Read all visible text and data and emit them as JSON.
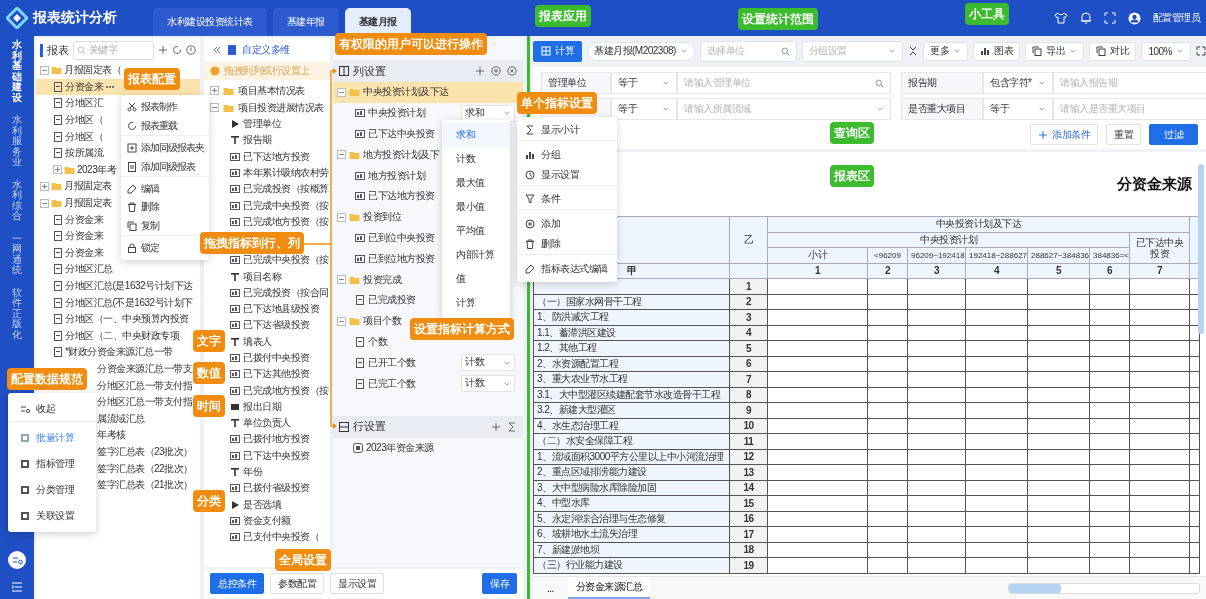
{
  "header": {
    "title": "报表统计分析",
    "tabs": [
      {
        "label": "水利建设投资统计表",
        "selected": false
      },
      {
        "label": "基建年报",
        "selected": false
      },
      {
        "label": "基建月报",
        "selected": true
      }
    ],
    "user": "配置管理员"
  },
  "nav": {
    "items": [
      {
        "label": "水利基础建设",
        "selected": true
      },
      {
        "label": "水利服务业",
        "selected": false
      },
      {
        "label": "水利综合",
        "selected": false
      },
      {
        "label": "一网通统",
        "selected": false
      },
      {
        "label": "软件正版化",
        "selected": false
      }
    ]
  },
  "report_panel": {
    "title": "报表",
    "search_placeholder": "关键字",
    "tree": [
      {
        "label": "月报固定表（",
        "kind": "folder",
        "expanded": true,
        "selected": false,
        "children": [
          {
            "label": "分资金来",
            "kind": "report",
            "selected": true
          },
          {
            "label": "分地区汇",
            "kind": "report",
            "selected": false
          },
          {
            "label": "分地区（",
            "kind": "report",
            "selected": false
          },
          {
            "label": "分地区（",
            "kind": "report",
            "selected": false
          },
          {
            "label": "按所属流",
            "kind": "report",
            "selected": false
          },
          {
            "label": "2023年考",
            "kind": "folder",
            "expanded": false,
            "selected": false
          }
        ]
      },
      {
        "label": "月报固定表",
        "kind": "folder",
        "expanded": false,
        "selected": false
      },
      {
        "label": "月报固定表",
        "kind": "folder",
        "expanded": true,
        "selected": false,
        "children": [
          {
            "label": "分资金来",
            "kind": "report",
            "selected": false
          },
          {
            "label": "分资金来",
            "kind": "report",
            "selected": false
          },
          {
            "label": "分资金来",
            "kind": "report",
            "selected": false
          },
          {
            "label": "分地区汇总",
            "kind": "report",
            "selected": false
          },
          {
            "label": "分地区汇总(是1632号计划下达",
            "kind": "report",
            "selected": false
          },
          {
            "label": "分地区汇总(不是1632号计划下",
            "kind": "report",
            "selected": false
          },
          {
            "label": "分地区（一、中央预算内投资",
            "kind": "report",
            "selected": false
          },
          {
            "label": "分地区（二、中央财政专项",
            "kind": "report",
            "selected": false
          },
          {
            "label": "*财政分资金来源汇总一带",
            "kind": "report",
            "selected": false
          },
          {
            "label": "分资金来源汇总一带支",
            "kind": "cut",
            "selected": false
          },
          {
            "label": "分地区汇总一带支付指",
            "kind": "cut",
            "selected": false
          },
          {
            "label": "分地区汇总一带支付指",
            "kind": "cut",
            "selected": false
          },
          {
            "label": "属流域汇总",
            "kind": "cut",
            "selected": false
          },
          {
            "label": "年考核",
            "kind": "cut",
            "selected": false
          },
          {
            "label": "签字汇总表（23批次）",
            "kind": "cut",
            "selected": false
          },
          {
            "label": "签字汇总表（22批次）",
            "kind": "cut",
            "selected": false
          },
          {
            "label": "签字汇总表（21批次）",
            "kind": "cut",
            "selected": false
          }
        ]
      }
    ]
  },
  "context_menu": [
    {
      "label": "报表制作",
      "kind": "make"
    },
    {
      "label": "报表重载",
      "kind": "reload",
      "divider": true
    },
    {
      "label": "添加同级报表夹",
      "kind": "addfolder"
    },
    {
      "label": "添加同级报表",
      "kind": "addreport",
      "divider": true
    },
    {
      "label": "编辑",
      "kind": "edit"
    },
    {
      "label": "删除",
      "kind": "delete"
    },
    {
      "label": "复制",
      "kind": "copy",
      "divider": true
    },
    {
      "label": "锁定",
      "kind": "lock"
    }
  ],
  "dimension_panel": {
    "title": "自定义多维",
    "hint": "拖拽到列或行设置上",
    "groups": [
      {
        "label": "项目基本情况表",
        "expanded": false
      },
      {
        "label": "项目投资进展情况表",
        "expanded": true,
        "fields": [
          {
            "label": "管理单位",
            "kind": "dimension"
          },
          {
            "label": "报告期",
            "kind": "text"
          },
          {
            "label": "已下达地方投资",
            "kind": "number"
          },
          {
            "label": "本年累计吸纳农村劳",
            "kind": "number"
          },
          {
            "label": "已完成投资（按概算",
            "kind": "number"
          },
          {
            "label": "已完成中央投资（按",
            "kind": "number"
          },
          {
            "label": "已完成地方投资（按",
            "kind": "number"
          },
          {
            "label": "已完成中央投资（按",
            "kind": "number"
          },
          {
            "label": "项目名称",
            "kind": "text"
          },
          {
            "label": "已完成投资（按合同",
            "kind": "number"
          },
          {
            "label": "已下达地县级投资",
            "kind": "number"
          },
          {
            "label": "已下达省级投资",
            "kind": "number"
          },
          {
            "label": "填表人",
            "kind": "text"
          },
          {
            "label": "已拨付中央投资",
            "kind": "number"
          },
          {
            "label": "已下达其他投资",
            "kind": "number"
          },
          {
            "label": "已完成地方投资（按",
            "kind": "number"
          },
          {
            "label": "报出日期",
            "kind": "date"
          },
          {
            "label": "单位负责人",
            "kind": "text"
          },
          {
            "label": "已拨付地方投资",
            "kind": "number"
          },
          {
            "label": "已下达中央投资",
            "kind": "number"
          },
          {
            "label": "年份",
            "kind": "text"
          },
          {
            "label": "已拨付省级投资",
            "kind": "number"
          },
          {
            "label": "是否选填",
            "kind": "dimension"
          },
          {
            "label": "资金支付额",
            "kind": "number"
          },
          {
            "label": "已支付中央投资（",
            "kind": "number"
          }
        ]
      }
    ]
  },
  "column_settings": {
    "title": "列设置",
    "items": [
      {
        "label": "中央投资计划及下达",
        "selected": true,
        "expanded": true,
        "children": [
          {
            "label": "中央投资计划",
            "kind": "number",
            "aggregate": "求和",
            "selected": false
          },
          {
            "label": "已下达中央投资",
            "kind": "number",
            "selected": false
          }
        ]
      },
      {
        "label": "地方投资计划及下",
        "selected": false,
        "expanded": true,
        "children": [
          {
            "label": "地方投资计划",
            "kind": "number",
            "selected": false
          },
          {
            "label": "已下达地方投资",
            "kind": "number",
            "selected": false
          }
        ]
      },
      {
        "label": "投资到位",
        "selected": false,
        "expanded": true,
        "children": [
          {
            "label": "已到位中央投资",
            "kind": "number",
            "selected": false
          },
          {
            "label": "已到位地方投资",
            "kind": "number",
            "selected": false
          }
        ]
      },
      {
        "label": "投资完成",
        "selected": false,
        "expanded": true,
        "children": [
          {
            "label": "已完成投资",
            "kind": "doc",
            "selected": false
          }
        ]
      },
      {
        "label": "项目个数",
        "selected": false,
        "expanded": true,
        "children": [
          {
            "label": "个数",
            "kind": "doc",
            "selected": false
          },
          {
            "label": "已开工个数",
            "kind": "doc",
            "aggregate": "计数",
            "selected": false
          },
          {
            "label": "已完工个数",
            "kind": "doc",
            "aggregate": "计数",
            "selected": false
          }
        ]
      }
    ]
  },
  "aggregate_menu": [
    {
      "label": "求和",
      "selected": true
    },
    {
      "label": "计数",
      "selected": false
    },
    {
      "label": "最大值",
      "selected": false
    },
    {
      "label": "最小值",
      "selected": false
    },
    {
      "label": "平均值",
      "selected": false
    },
    {
      "label": "内部计算",
      "selected": false
    },
    {
      "label": "值",
      "selected": false
    },
    {
      "label": "计算",
      "selected": false
    }
  ],
  "row_settings": {
    "title": "行设置",
    "items": [
      {
        "label": "2023年资金来源"
      }
    ]
  },
  "bottom_bar": [
    {
      "label": "总控条件",
      "kind": "primary"
    },
    {
      "label": "参数配置",
      "kind": "default"
    },
    {
      "label": "显示设置",
      "kind": "default"
    },
    {
      "label": "保存",
      "kind": "primary"
    }
  ],
  "indicator_menu": [
    {
      "label": "显示小计",
      "kind": "sum",
      "divider": true
    },
    {
      "label": "分组",
      "kind": "bars"
    },
    {
      "label": "显示设置",
      "kind": "clock",
      "divider": true
    },
    {
      "label": "条件",
      "kind": "filter",
      "divider": true
    },
    {
      "label": "添加",
      "kind": "add"
    },
    {
      "label": "删除",
      "kind": "delete",
      "divider": true
    },
    {
      "label": "指标表达式编辑",
      "kind": "edit"
    }
  ],
  "side_popup": {
    "collapse": "收起",
    "items": [
      {
        "label": "批量计算",
        "selected": true
      },
      {
        "label": "指标管理",
        "selected": false
      },
      {
        "label": "分类管理",
        "selected": false
      },
      {
        "label": "关联设置",
        "selected": false
      }
    ]
  },
  "toolbar": {
    "calc": "计算",
    "report_select": "基建月报(M202308)",
    "unit_placeholder": "选择单位",
    "group_placeholder": "分组设置",
    "more": "更多",
    "chart": "图表",
    "export": "导出",
    "compare": "对比",
    "zoom": "100%"
  },
  "filters": [
    {
      "label": "管理单位",
      "operator": "等于",
      "placeholder": "请输入管理单位",
      "kind": "search"
    },
    {
      "label": "报告期",
      "operator": "包含字符*",
      "placeholder": "请输入报告期",
      "kind": "text"
    },
    {
      "operator": "等于",
      "placeholder": "请输入所属流域",
      "kind": "select"
    },
    {
      "label": "是否重大项目",
      "operator": "等于",
      "placeholder": "请输入是否重大项目",
      "kind": "text"
    }
  ],
  "filter_buttons": {
    "add": "添加条件",
    "reset": "重置",
    "apply": "过滤"
  },
  "report": {
    "title": "分资金来源",
    "group": "中央投资计划及下达",
    "subgroup": "中央投资计划",
    "code_column": "乙",
    "released": "已下达中央投资",
    "ranges": [
      "小计",
      "<96209",
      "96209~192418",
      "192418~288627",
      "288627~384836",
      "384836=<"
    ],
    "numbers": [
      "甲",
      "1",
      "2",
      "3",
      "4",
      "5",
      "6",
      "7"
    ],
    "rows": [
      {
        "index": "1"
      },
      {
        "label": "（一）国家水网骨干工程",
        "index": "2"
      },
      {
        "label": "1、防洪减灾工程",
        "index": "3"
      },
      {
        "label": "1.1、蓄滞洪区建设",
        "index": "4"
      },
      {
        "label": "1.2、其他工程",
        "index": "5"
      },
      {
        "label": "2、水资源配置工程",
        "index": "6"
      },
      {
        "label": "3、重大农业节水工程",
        "index": "7"
      },
      {
        "label": "3.1、大中型灌区续建配套节水改造骨干工程",
        "index": "8"
      },
      {
        "label": "3.2、新建大型灌区",
        "index": "9"
      },
      {
        "label": "4、水生态治理工程",
        "index": "10"
      },
      {
        "label": "（二）水安全保障工程",
        "index": "11"
      },
      {
        "label": "1、流域面积3000平方公里以上中小河流治理",
        "index": "12"
      },
      {
        "label": "2、重点区域排涝能力建设",
        "index": "13"
      },
      {
        "label": "3、大中型病险水库除险加固",
        "index": "14"
      },
      {
        "label": "4、中型水库",
        "index": "15"
      },
      {
        "label": "5、永定河综合治理与生态修复",
        "index": "16"
      },
      {
        "label": "6、坡耕地水土流失治理",
        "index": "17"
      },
      {
        "label": "7、新建淤地坝",
        "index": "18"
      },
      {
        "label": "（三）行业能力建设",
        "index": "19"
      }
    ]
  },
  "sheet_tabs": [
    {
      "label": "...",
      "selected": false
    },
    {
      "label": "分资金来源汇总",
      "selected": true
    }
  ],
  "annotations": [
    {
      "text": "报表应用",
      "color": "#3dbb2f"
    },
    {
      "text": "设置统计范围",
      "color": "#3dbb2f"
    },
    {
      "text": "小工具",
      "color": "#3dbb2f"
    },
    {
      "text": "报表配置",
      "color": "#f08c0f"
    },
    {
      "text": "有权限的用户可以进行操作",
      "color": "#f08c0f"
    },
    {
      "text": "单个指标设置",
      "color": "#f08c0f"
    },
    {
      "text": "查询区",
      "color": "#3dbb2f"
    },
    {
      "text": "报表区",
      "color": "#3dbb2f"
    },
    {
      "text": "拖拽指标到行、列",
      "color": "#f08c0f"
    },
    {
      "text": "设置指标计算方式",
      "color": "#f08c0f"
    },
    {
      "text": "文字",
      "color": "#f08c0f"
    },
    {
      "text": "数值",
      "color": "#f08c0f"
    },
    {
      "text": "时间",
      "color": "#f08c0f"
    },
    {
      "text": "配置数据规范",
      "color": "#f08c0f"
    },
    {
      "text": "分类",
      "color": "#f08c0f"
    },
    {
      "text": "全局设置",
      "color": "#f08c0f"
    }
  ]
}
